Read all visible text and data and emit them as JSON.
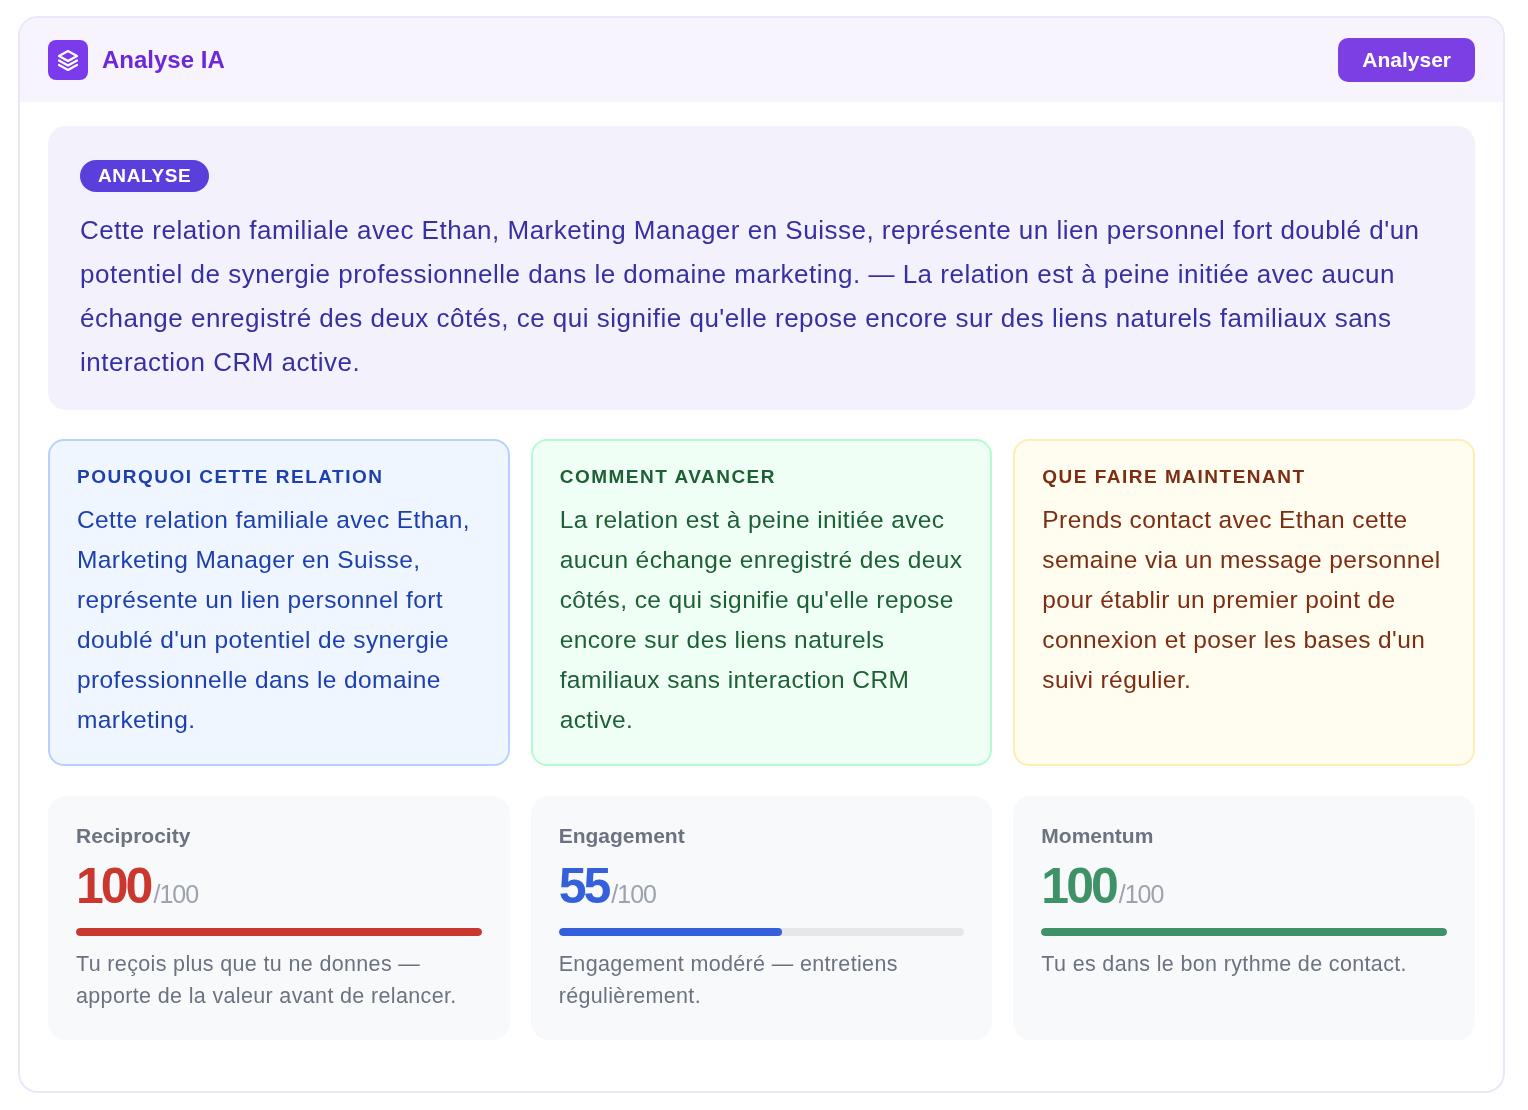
{
  "panel": {
    "title": "Analyse IA",
    "action_button": "Analyser"
  },
  "analysis": {
    "badge": "ANALYSE",
    "text": "Cette relation familiale avec Ethan, Marketing Manager en Suisse, représente un lien personnel fort doublé d'un potentiel de synergie professionnelle dans le domaine marketing. — La relation est à peine initiée avec aucun échange enregistré des deux côtés, ce qui signifie qu'elle repose encore sur des liens naturels familiaux sans interaction CRM active."
  },
  "insights": [
    {
      "title": "POURQUOI CETTE RELATION",
      "text": "Cette relation familiale avec Ethan, Marketing Manager en Suisse, représente un lien personnel fort doublé d'un potentiel de synergie professionnelle dans le domaine marketing.",
      "color": "#1e40af"
    },
    {
      "title": "COMMENT AVANCER",
      "text": "La relation est à peine initiée avec aucun échange enregistré des deux côtés, ce qui signifie qu'elle repose encore sur des liens naturels familiaux sans interaction CRM active.",
      "color": "#1d6035"
    },
    {
      "title": "QUE FAIRE MAINTENANT",
      "text": "Prends contact avec Ethan cette semaine via un message personnel pour établir un premier point de connexion et poser les bases d'un suivi régulier.",
      "color": "#7c2d12"
    }
  ],
  "metrics": [
    {
      "label": "Reciprocity",
      "score": "100",
      "max": "/100",
      "level": 1,
      "color": "#c9372f",
      "note": "Tu reçois plus que tu ne donnes — apporte de la valeur avant de relancer."
    },
    {
      "label": "Engagement",
      "score": "55",
      "max": "/100",
      "level": 0.55,
      "color": "#3461db",
      "note": "Engagement modéré — entretiens régulièrement."
    },
    {
      "label": "Momentum",
      "score": "100",
      "max": "/100",
      "level": 1,
      "color": "#3f9268",
      "note": "Tu es dans le bon rythme de contact."
    }
  ]
}
